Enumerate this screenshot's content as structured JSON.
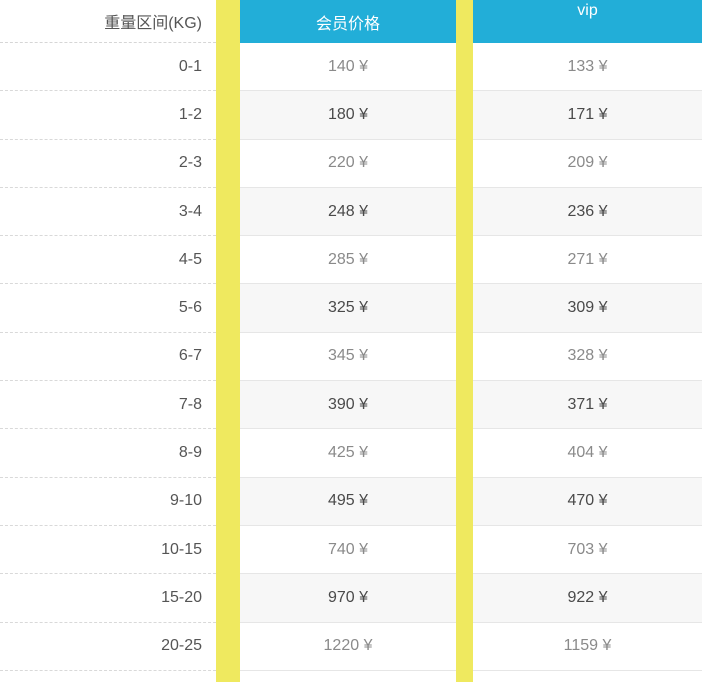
{
  "table": {
    "label_header": "重量区间(KG)",
    "member_header": "会员价格",
    "vip_header": "vip",
    "rows": [
      {
        "range": "0-1",
        "member": "140 ¥",
        "vip": "133 ¥"
      },
      {
        "range": "1-2",
        "member": "180 ¥",
        "vip": "171 ¥"
      },
      {
        "range": "2-3",
        "member": "220 ¥",
        "vip": "209 ¥"
      },
      {
        "range": "3-4",
        "member": "248 ¥",
        "vip": "236 ¥"
      },
      {
        "range": "4-5",
        "member": "285 ¥",
        "vip": "271 ¥"
      },
      {
        "range": "5-6",
        "member": "325 ¥",
        "vip": "309 ¥"
      },
      {
        "range": "6-7",
        "member": "345 ¥",
        "vip": "328 ¥"
      },
      {
        "range": "7-8",
        "member": "390 ¥",
        "vip": "371 ¥"
      },
      {
        "range": "8-9",
        "member": "425 ¥",
        "vip": "404 ¥"
      },
      {
        "range": "9-10",
        "member": "495 ¥",
        "vip": "470 ¥"
      },
      {
        "range": "10-15",
        "member": "740 ¥",
        "vip": "703 ¥"
      },
      {
        "range": "15-20",
        "member": "970 ¥",
        "vip": "922 ¥"
      },
      {
        "range": "20-25",
        "member": "1220 ¥",
        "vip": "1159 ¥"
      }
    ]
  },
  "colors": {
    "header_blue": "#22aed8",
    "divider_yellow": "#efe95f",
    "alt_row": "#f7f7f7"
  }
}
